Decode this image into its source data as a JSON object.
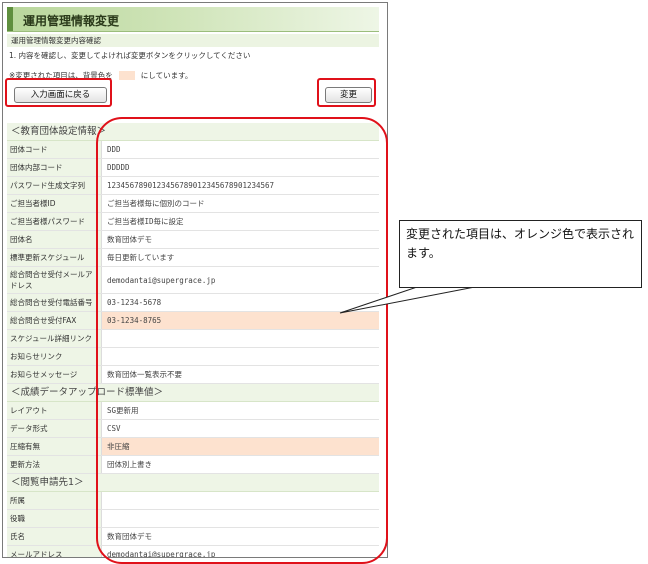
{
  "title": "運用管理情報変更",
  "subtitle": "運用管理情報変更内容確認",
  "instruction": "1. 内容を確認し、変更してよければ変更ボタンをクリックしてください",
  "legend": {
    "prefix": "※変更された項目は、背景色を",
    "suffix": "にしています。",
    "swatch_color": "#fde2cf"
  },
  "buttons": {
    "back": "入力画面に戻る",
    "change": "変更"
  },
  "sections": [
    {
      "title": "＜教育団体設定情報＞",
      "rows": [
        {
          "label": "団体コード",
          "value": "DDD"
        },
        {
          "label": "団体内部コード",
          "value": "DDDDD"
        },
        {
          "label": "パスワード生成文字列",
          "value": "1234567890123456789012345678901234567"
        },
        {
          "label": "ご担当者様ID",
          "value": "ご担当者様毎に個別のコード"
        },
        {
          "label": "ご担当者様パスワード",
          "value": "ご担当者様ID毎に設定"
        },
        {
          "label": "団体名",
          "value": "数育団体デモ"
        },
        {
          "label": "標準更新スケジュール",
          "value": "毎日更新しています"
        },
        {
          "label": "総合問合せ受付メールアドレス",
          "value": "demodantai@supergrace.jp"
        },
        {
          "label": "総合問合せ受付電話番号",
          "value": "03-1234-5678"
        },
        {
          "label": "総合問合せ受付FAX",
          "value": "03-1234-8765",
          "changed": true
        },
        {
          "label": "スケジュール詳細リンク",
          "value": ""
        },
        {
          "label": "お知らせリンク",
          "value": ""
        },
        {
          "label": "お知らせメッセージ",
          "value": "数育団体一覧表示不要"
        }
      ]
    },
    {
      "title": "＜成績データアップロード標準値＞",
      "rows": [
        {
          "label": "レイアウト",
          "value": "SG更新用"
        },
        {
          "label": "データ形式",
          "value": "CSV"
        },
        {
          "label": "圧縮有無",
          "value": "非圧縮",
          "changed": true
        },
        {
          "label": "更新方法",
          "value": "団体別上書き"
        }
      ]
    },
    {
      "title": "＜閲覧申請先1＞",
      "rows": [
        {
          "label": "所属",
          "value": ""
        },
        {
          "label": "役職",
          "value": ""
        },
        {
          "label": "氏名",
          "value": "数育団体デモ"
        },
        {
          "label": "メールアドレス",
          "value": "demodantai@supergrace.jp"
        }
      ]
    }
  ],
  "callout": "変更された項目は、オレンジ色で表示されます。"
}
